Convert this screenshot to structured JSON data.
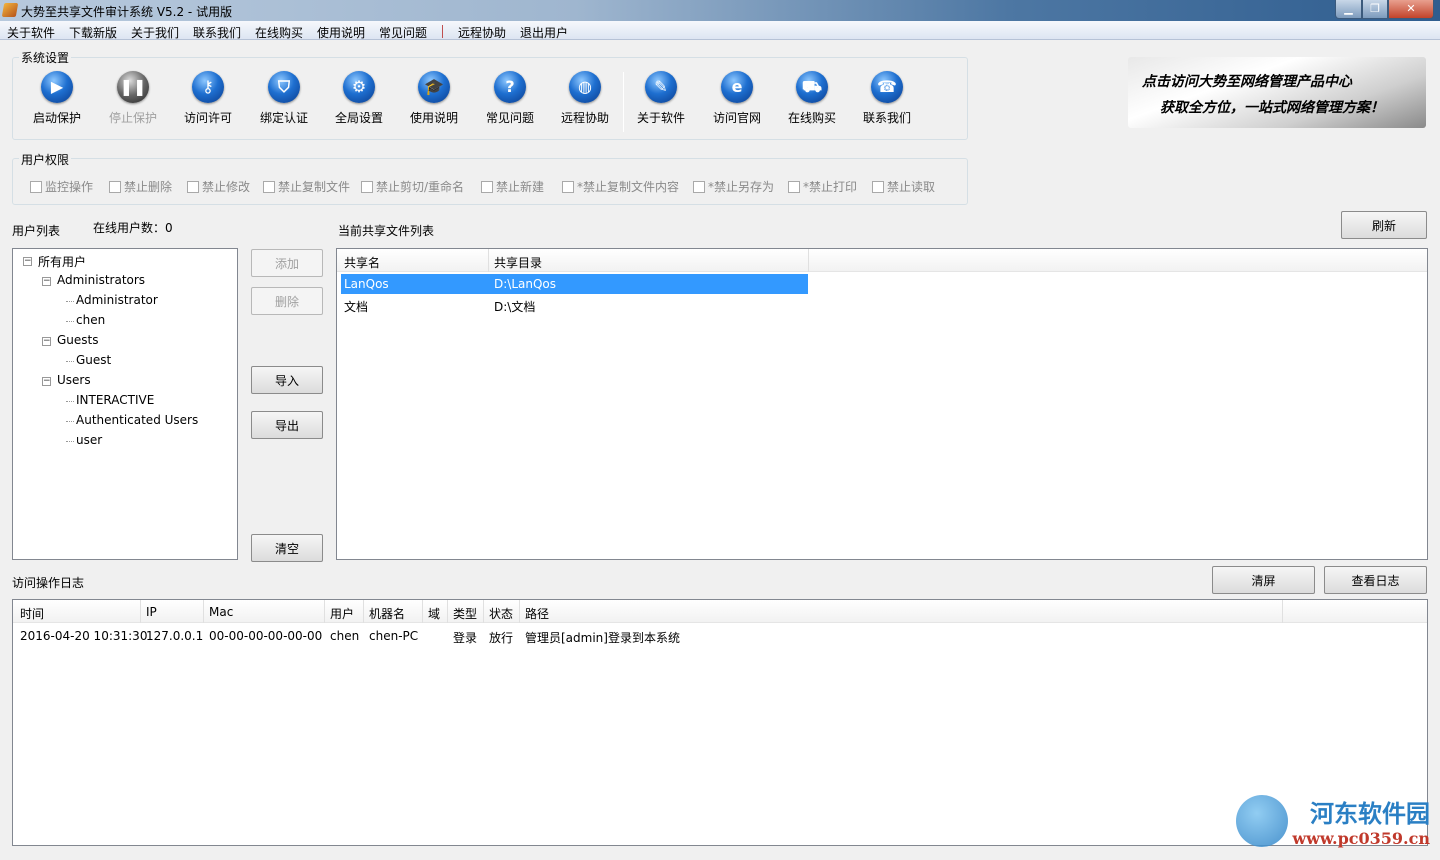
{
  "window": {
    "title": "大势至共享文件审计系统 V5.2 - 试用版",
    "controls": [
      "minimize",
      "restore",
      "close"
    ]
  },
  "menu": [
    "关于软件",
    "下载新版",
    "关于我们",
    "联系我们",
    "在线购买",
    "使用说明",
    "常见问题",
    "远程协助",
    "退出用户"
  ],
  "system_settings": {
    "title": "系统设置",
    "tools": [
      {
        "label": "启动保护",
        "icon": "play-icon",
        "glyph": "▶",
        "enabled": true
      },
      {
        "label": "停止保护",
        "icon": "pause-icon",
        "glyph": "❚❚",
        "enabled": false
      },
      {
        "label": "访问许可",
        "icon": "key-icon",
        "glyph": "⚷",
        "enabled": true
      },
      {
        "label": "绑定认证",
        "icon": "shield-icon",
        "glyph": "⛉",
        "enabled": true
      },
      {
        "label": "全局设置",
        "icon": "gear-icon",
        "glyph": "⚙",
        "enabled": true
      },
      {
        "label": "使用说明",
        "icon": "graduation-cap-icon",
        "glyph": "🎓",
        "enabled": true
      },
      {
        "label": "常见问题",
        "icon": "question-icon",
        "glyph": "?",
        "enabled": true
      },
      {
        "label": "远程协助",
        "icon": "globe-hand-icon",
        "glyph": "◍",
        "enabled": true
      },
      {
        "label": "关于软件",
        "icon": "document-icon",
        "glyph": "✎",
        "enabled": true
      },
      {
        "label": "访问官网",
        "icon": "ie-icon",
        "glyph": "e",
        "enabled": true
      },
      {
        "label": "在线购买",
        "icon": "cart-icon",
        "glyph": "⛟",
        "enabled": true
      },
      {
        "label": "联系我们",
        "icon": "phone-icon",
        "glyph": "☎",
        "enabled": true
      }
    ]
  },
  "banner": {
    "line1": "点击访问大势至网络管理产品中心",
    "line2": "获取全方位，一站式网络管理方案！"
  },
  "permissions": {
    "title": "用户权限",
    "items": [
      "监控操作",
      "禁止删除",
      "禁止修改",
      "禁止复制文件",
      "禁止剪切/重命名",
      "禁止新建",
      "*禁止复制文件内容",
      "*禁止另存为",
      "*禁止打印",
      "禁止读取"
    ]
  },
  "users": {
    "title": "用户列表",
    "online_count": "在线用户数：0",
    "tree": [
      {
        "label": "所有用户",
        "level": 0,
        "toggle": "⊟"
      },
      {
        "label": "Administrators",
        "level": 1,
        "toggle": "⊟"
      },
      {
        "label": "Administrator",
        "level": 2
      },
      {
        "label": "chen",
        "level": 2
      },
      {
        "label": "Guests",
        "level": 1,
        "toggle": "⊟"
      },
      {
        "label": "Guest",
        "level": 2
      },
      {
        "label": "Users",
        "level": 1,
        "toggle": "⊟"
      },
      {
        "label": "INTERACTIVE",
        "level": 2
      },
      {
        "label": "Authenticated Users",
        "level": 2
      },
      {
        "label": "user",
        "level": 2
      }
    ],
    "buttons": {
      "add": "添加",
      "delete": "删除",
      "import": "导入",
      "export": "导出",
      "clear": "清空"
    }
  },
  "shares": {
    "title": "当前共享文件列表",
    "refresh": "刷新",
    "columns": [
      "共享名",
      "共享目录"
    ],
    "rows": [
      {
        "name": "LanQos",
        "path": "D:\\LanQos",
        "selected": true
      },
      {
        "name": "文档",
        "path": "D:\\文档",
        "selected": false
      }
    ]
  },
  "log": {
    "title": "访问操作日志",
    "clear_screen": "清屏",
    "view_log": "查看日志",
    "columns": [
      "时间",
      "IP",
      "Mac",
      "用户",
      "机器名",
      "域",
      "类型",
      "状态",
      "路径"
    ],
    "rows": [
      [
        "2016-04-20 10:31:30",
        "127.0.0.1",
        "00-00-00-00-00-00",
        "chen",
        "chen-PC",
        "",
        "登录",
        "放行",
        "管理员[admin]登录到本系统"
      ]
    ]
  },
  "watermark": {
    "name": "河东软件园",
    "url": "www.pc0359.cn"
  },
  "colors": {
    "selection": "#3399ff",
    "icon_blue": "#1e6fd0"
  }
}
